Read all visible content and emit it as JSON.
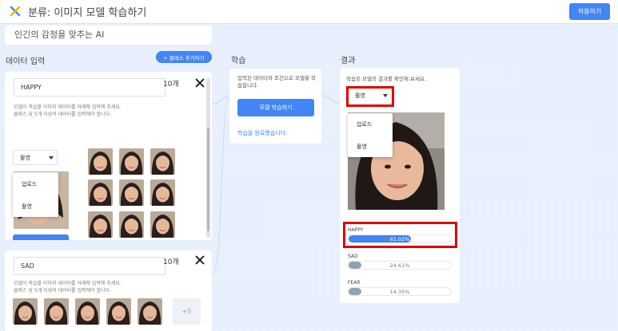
{
  "header": {
    "title": "분류: 이미지 모델 학습하기",
    "apply_label": "적용하기",
    "logo_icon": "x-logo-icon"
  },
  "colors": {
    "accent": "#4285f4",
    "bar_secondary": "#8ea3b4",
    "highlight": "#e00000"
  },
  "canvas": {
    "subtitle": "인긴의 감정을 맞추는 AI",
    "data_input_label": "데이터 입력",
    "add_class_label": "+ 클래스 추가하기",
    "train_label": "학습",
    "result_label": "결과"
  },
  "classes": [
    {
      "name": "HAPPY",
      "count": "10개",
      "desc1": "모델이 학습할 이미지 데이터를 아래에 입력해 주세요.",
      "desc2": "클래스 당 5개 이상의 데이터를 입력해야 합니다.",
      "dropdown": {
        "selected": "촬영",
        "options": [
          "업로드",
          "촬영"
        ]
      },
      "camera_icon": "camera-icon",
      "image_count": 10
    },
    {
      "name": "SAD",
      "count": "10개",
      "desc1": "모델이 학습할 이미지 데이터를 아래에 입력해 주세요.",
      "desc2": "클래스 당 5개 이상의 데이터를 입력해야 합니다.",
      "more": "+5",
      "image_count": 5
    }
  ],
  "train": {
    "text": "입력된 데이터와 조건으로 모델을 학습합니다.",
    "button": "모델 학습하기",
    "done": "학습을 완료했습니다."
  },
  "result": {
    "desc": "학습된 모델의 결과를 확인해 보세요.",
    "dropdown": {
      "selected": "촬영",
      "options": [
        "업로드",
        "촬영"
      ]
    },
    "predictions": [
      {
        "label": "HAPPY",
        "value": 61.02,
        "text": "61.02%"
      },
      {
        "label": "SAD",
        "value": 24.61,
        "text": "24.61%"
      },
      {
        "label": "FEAR",
        "value": 14.35,
        "text": "14.35%"
      }
    ]
  }
}
